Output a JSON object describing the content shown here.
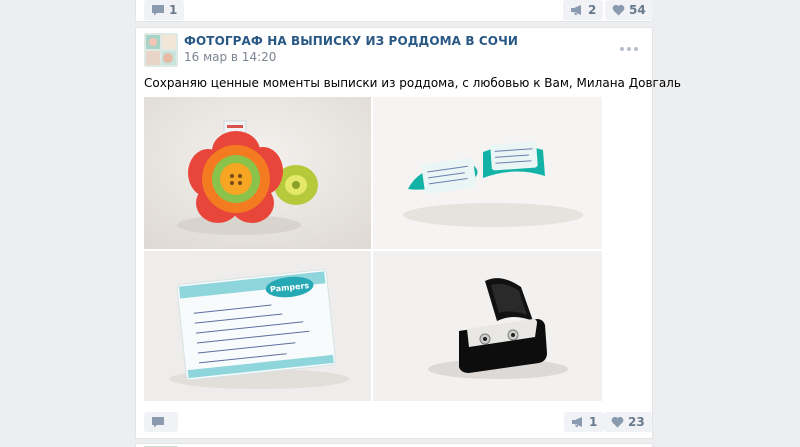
{
  "previous_post": {
    "comments_count": "",
    "comment_count_value": "1",
    "reposts_count": "2",
    "likes_count": "54"
  },
  "post": {
    "author": "ФОТОГРАФ НА ВЫПИСКУ ИЗ РОДДОМА В СОЧИ",
    "date": "16 мар в 14:20",
    "text": "Сохраняю ценные моменты выписки из роддома, с любовью к Вам, Милана Довгаль",
    "photos": [
      {
        "subject": "flower-toy"
      },
      {
        "subject": "teal-baby-tags"
      },
      {
        "subject": "pampers-card"
      },
      {
        "subject": "earrings-in-box"
      }
    ],
    "footer": {
      "reposts_count": "1",
      "likes_count": "23"
    }
  },
  "colors": {
    "page_bg": "#edeef0",
    "card_bg": "#ffffff",
    "author": "#2a5885",
    "meta": "#7b8491",
    "action": "#697a8d",
    "pill_bg": "#f0f2f5"
  },
  "icons": [
    "comment-icon",
    "megaphone-icon",
    "heart-icon",
    "more-icon"
  ]
}
